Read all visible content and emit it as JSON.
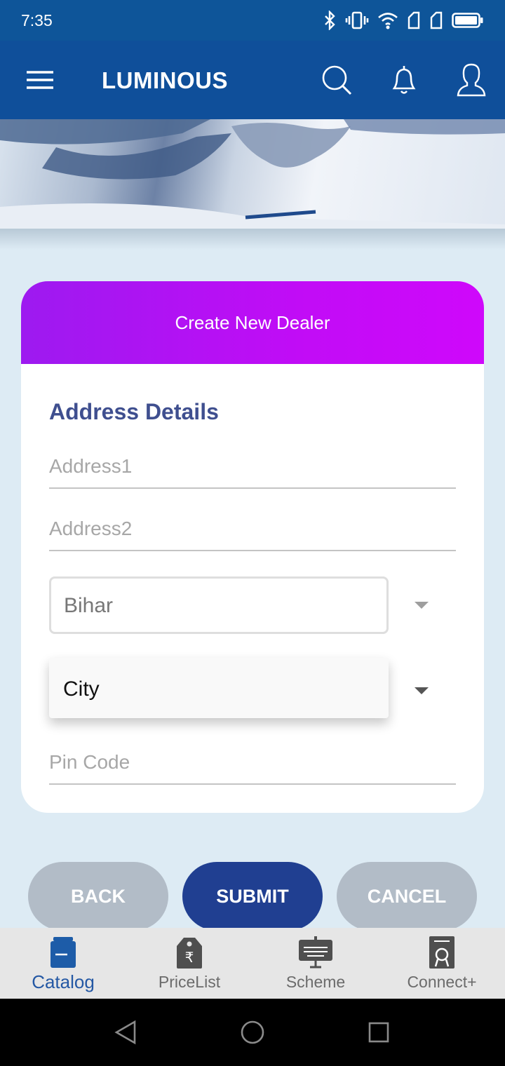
{
  "status_bar": {
    "time": "7:35"
  },
  "app_bar": {
    "title": "LUMINOUS"
  },
  "form": {
    "header": "Create New Dealer",
    "section_title": "Address Details",
    "address1_placeholder": "Address1",
    "address2_placeholder": "Address2",
    "state_value": "Bihar",
    "city_value": "City",
    "pincode_placeholder": "Pin Code"
  },
  "buttons": {
    "back": "BACK",
    "submit": "SUBMIT",
    "cancel": "CANCEL"
  },
  "bottom_nav": {
    "items": [
      {
        "label": "Catalog",
        "icon": "catalog-icon",
        "active": true
      },
      {
        "label": "PriceList",
        "icon": "price-tag-icon",
        "active": false
      },
      {
        "label": "Scheme",
        "icon": "scheme-board-icon",
        "active": false
      },
      {
        "label": "Connect+",
        "icon": "certificate-icon",
        "active": false
      }
    ]
  },
  "colors": {
    "app_bar": "#0f4f9a",
    "header_gradient_start": "#9d1af0",
    "header_gradient_end": "#cf08fb",
    "submit": "#203f91",
    "secondary_button": "#b2bcc7",
    "active_nav": "#2458a4"
  }
}
